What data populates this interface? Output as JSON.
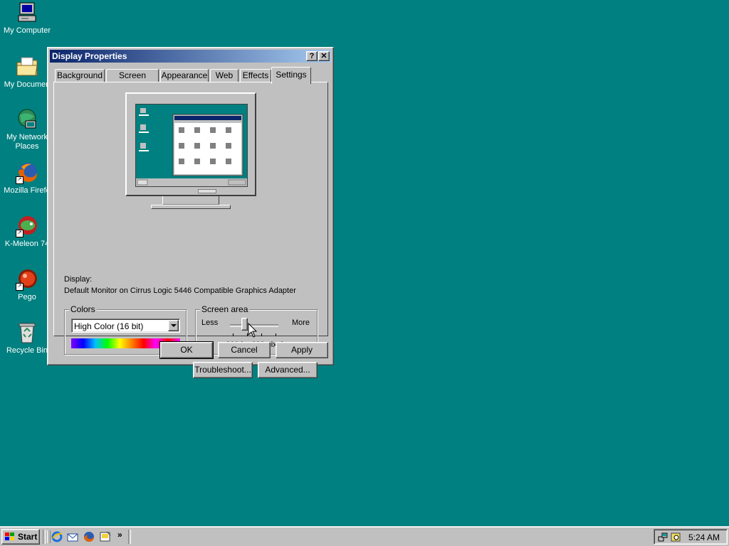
{
  "desktop": {
    "icons": [
      {
        "label": "My Computer",
        "icon": "computer-icon"
      },
      {
        "label": "My Documen",
        "icon": "folder-icon"
      },
      {
        "label": "My Network Places",
        "icon": "network-icon"
      },
      {
        "label": "Mozilla Firefo",
        "icon": "firefox-icon"
      },
      {
        "label": "K-Meleon 74",
        "icon": "kmeleon-icon"
      },
      {
        "label": "Pego",
        "icon": "pego-icon"
      },
      {
        "label": "Recycle Bin",
        "icon": "recycle-bin-icon"
      }
    ]
  },
  "dialog": {
    "title": "Display Properties",
    "help_glyph": "?",
    "close_glyph": "✕",
    "tabs": [
      {
        "label": "Background"
      },
      {
        "label": "Screen Saver"
      },
      {
        "label": "Appearance"
      },
      {
        "label": "Web"
      },
      {
        "label": "Effects"
      },
      {
        "label": "Settings",
        "active": true
      }
    ],
    "display_label": "Display:",
    "display_value": "Default Monitor on Cirrus Logic 5446 Compatible Graphics Adapter",
    "colors": {
      "legend": "Colors",
      "selected": "High Color (16 bit)"
    },
    "screen_area": {
      "legend": "Screen area",
      "less_label": "Less",
      "more_label": "More",
      "value_text": "800 by 600 pixels",
      "slider_position": 0.3
    },
    "buttons": {
      "troubleshoot": "Troubleshoot...",
      "advanced": "Advanced...",
      "ok": "OK",
      "cancel": "Cancel",
      "apply": "Apply"
    }
  },
  "taskbar": {
    "start_label": "Start",
    "quick_launch": [
      "ie-icon",
      "outlook-icon",
      "firefox-icon",
      "desktop-icon"
    ],
    "chevron": "»",
    "clock": "5:24 AM"
  }
}
